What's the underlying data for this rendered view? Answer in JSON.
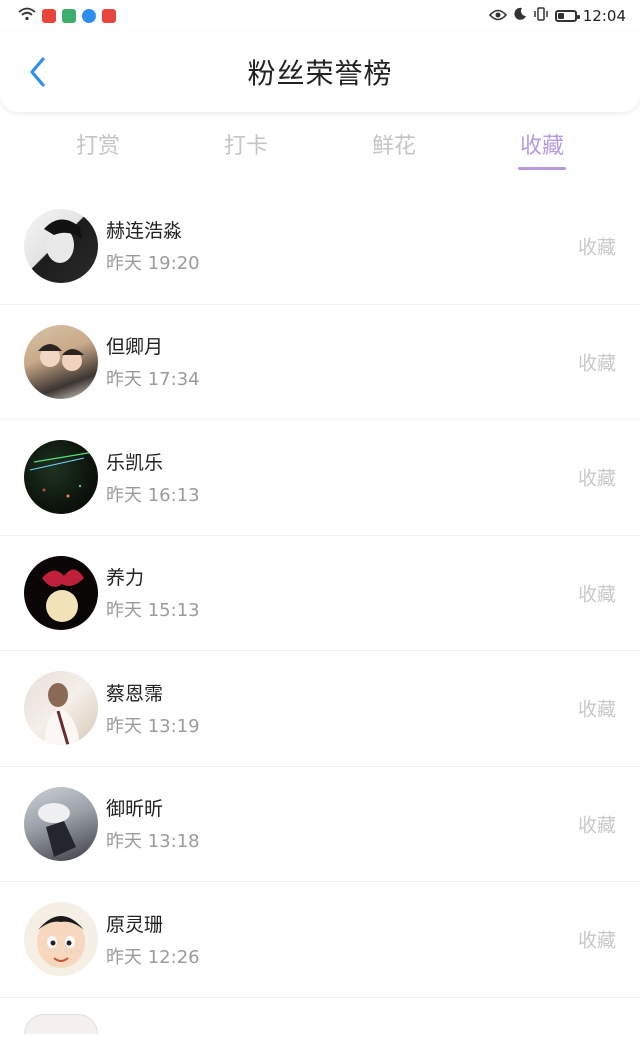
{
  "status_bar": {
    "time": "12:04",
    "icons": [
      "wifi-icon",
      "app-icon",
      "app-icon",
      "app-icon",
      "app-icon",
      "eye-icon",
      "moon-icon",
      "vibrate-icon",
      "battery-icon"
    ]
  },
  "header": {
    "title": "粉丝荣誉榜",
    "back_icon": "chevron-left-icon"
  },
  "tabs": [
    {
      "label": "打赏",
      "active": false
    },
    {
      "label": "打卡",
      "active": false
    },
    {
      "label": "鲜花",
      "active": false
    },
    {
      "label": "收藏",
      "active": true
    }
  ],
  "colors": {
    "accent": "#b69be0",
    "back_icon": "#2f8ff0",
    "muted": "#c5c5c5"
  },
  "list": [
    {
      "name": "赫连浩淼",
      "time": "昨天 19:20",
      "action": "收藏"
    },
    {
      "name": "但卿月",
      "time": "昨天 17:34",
      "action": "收藏"
    },
    {
      "name": "乐凯乐",
      "time": "昨天 16:13",
      "action": "收藏"
    },
    {
      "name": "养力",
      "time": "昨天 15:13",
      "action": "收藏"
    },
    {
      "name": "蔡恩霈",
      "time": "昨天 13:19",
      "action": "收藏"
    },
    {
      "name": "御昕昕",
      "time": "昨天 13:18",
      "action": "收藏"
    },
    {
      "name": "原灵珊",
      "time": "昨天 12:26",
      "action": "收藏"
    }
  ]
}
